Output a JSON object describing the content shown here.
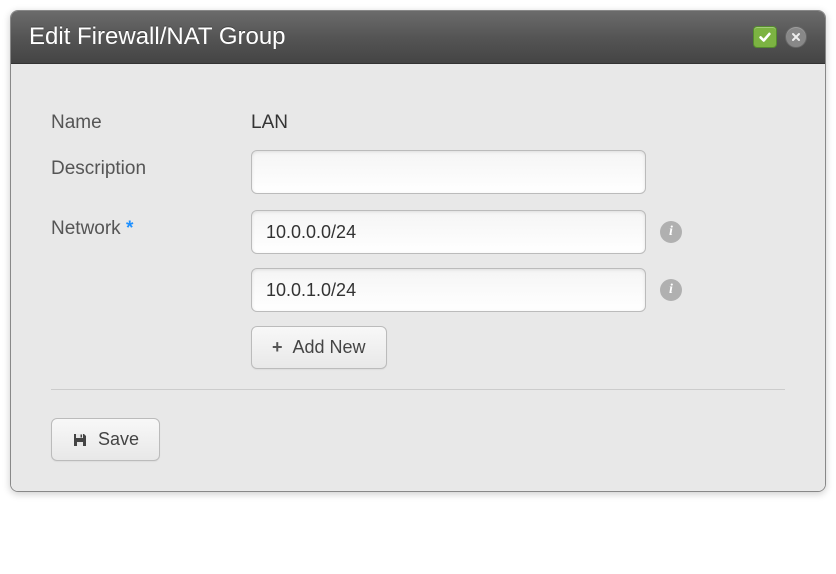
{
  "dialog": {
    "title": "Edit Firewall/NAT Group"
  },
  "form": {
    "name_label": "Name",
    "name_value": "LAN",
    "description_label": "Description",
    "description_value": "",
    "network_label": "Network",
    "required_mark": "*",
    "networks": [
      {
        "value": "10.0.0.0/24"
      },
      {
        "value": "10.0.1.0/24"
      }
    ],
    "add_new_label": "Add New",
    "save_label": "Save"
  }
}
